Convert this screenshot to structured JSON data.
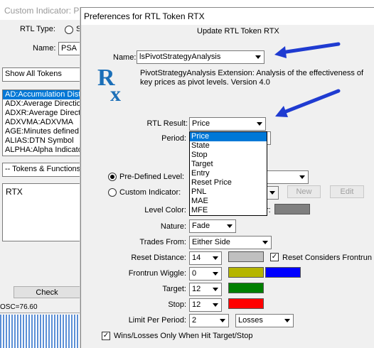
{
  "background": {
    "title": "Custom Indicator: PSA",
    "rtl_type_label": "RTL Type:",
    "rtl_type_option": "S",
    "name_label": "Name:",
    "name_value": "PSA",
    "filter_value": "Show All Tokens",
    "tokens": [
      "AD:Accumulation Distr",
      "ADX:Average Direction",
      "ADXR:Average Directio",
      "ADXVMA:ADXVMA",
      "AGE:Minutes defined",
      "ALIAS:DTN Symbol",
      "ALPHA:Alpha Indicator"
    ],
    "tokens_functions_value": "-- Tokens & Functions",
    "expression": "RTX",
    "check_button": "Check",
    "status_value": "OSC=76.60"
  },
  "dialog": {
    "title": "Preferences for RTL Token RTX",
    "header": "Update RTL Token RTX",
    "name_label": "Name:",
    "name_value": "lsPivotStrategyAnalysis",
    "description": "PivotStrategyAnalysis Extension: Analysis of the effectiveness of key prices as pivot levels. Version 4.0",
    "logo_text": "Rx",
    "rtl_result_label": "RTL Result:",
    "rtl_result_value": "Price",
    "rtl_result_options": [
      "Price",
      "State",
      "Stop",
      "Target",
      "Entry",
      "Reset Price",
      "PNL",
      "MAE",
      "MFE"
    ],
    "period_label": "Period:",
    "predefined_label": "Pre-Defined Level:",
    "custom_indicator_label": "Custom Indicator:",
    "new_button": "New",
    "edit_button": "Edit",
    "level_color_label": "Level Color:",
    "level_color_suffix": "r:",
    "level_color": "#7f7f7f",
    "nature_label": "Nature:",
    "nature_value": "Fade",
    "trades_from_label": "Trades From:",
    "trades_from_value": "Either Side",
    "reset_distance_label": "Reset Distance:",
    "reset_distance_value": "14",
    "reset_distance_color": "#c0c0c0",
    "reset_considers_label": "Reset Considers Frontrun",
    "frontrun_label": "Frontrun Wiggle:",
    "frontrun_value": "0",
    "frontrun_color1": "#b5b500",
    "frontrun_color2": "#0000ff",
    "target_label": "Target:",
    "target_value": "12",
    "target_color": "#008000",
    "stop_label": "Stop:",
    "stop_value": "12",
    "stop_color": "#ff0000",
    "limit_label": "Limit Per Period:",
    "limit_value": "2",
    "limit_type_value": "Losses",
    "wins_losses_label": "Wins/Losses Only When Hit Target/Stop"
  },
  "colors": {
    "arrow": "#1f3bd1",
    "selection": "#0078d7"
  }
}
